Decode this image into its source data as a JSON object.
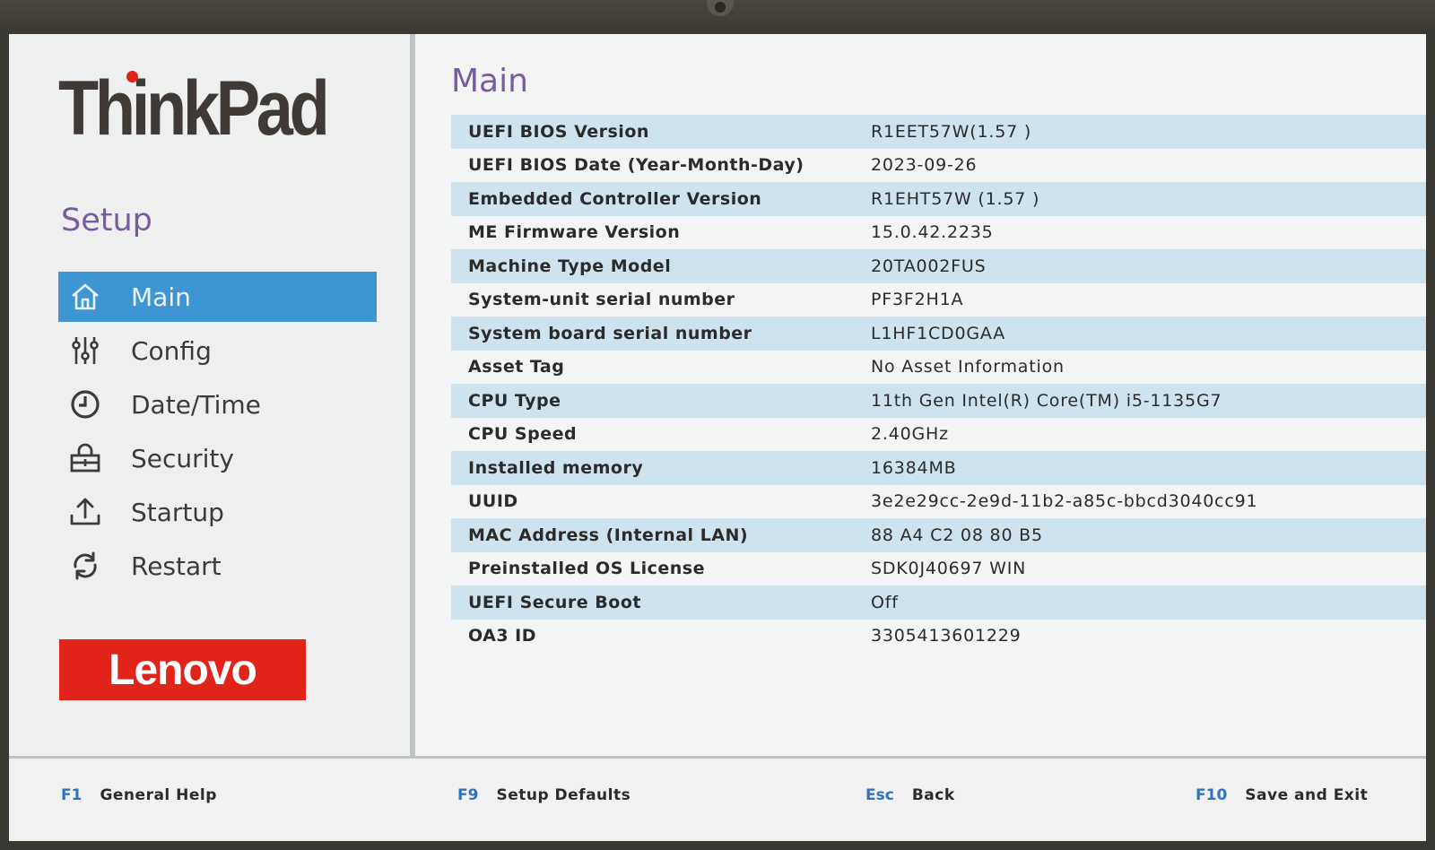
{
  "brand": {
    "name": "ThinkPad",
    "logo": "Lenovo"
  },
  "sidebar": {
    "title": "Setup",
    "items": [
      {
        "label": "Main",
        "icon": "home-icon",
        "active": true
      },
      {
        "label": "Config",
        "icon": "sliders-icon",
        "active": false
      },
      {
        "label": "Date/Time",
        "icon": "clock-icon",
        "active": false
      },
      {
        "label": "Security",
        "icon": "lock-icon",
        "active": false
      },
      {
        "label": "Startup",
        "icon": "upload-icon",
        "active": false
      },
      {
        "label": "Restart",
        "icon": "restart-icon",
        "active": false
      }
    ]
  },
  "main": {
    "title": "Main",
    "rows": [
      {
        "label": "UEFI BIOS Version",
        "value": "R1EET57W(1.57 )"
      },
      {
        "label": "UEFI BIOS Date (Year-Month-Day)",
        "value": "2023-09-26"
      },
      {
        "label": "Embedded Controller Version",
        "value": "R1EHT57W (1.57 )"
      },
      {
        "label": "ME Firmware Version",
        "value": "15.0.42.2235"
      },
      {
        "label": "Machine Type Model",
        "value": "20TA002FUS"
      },
      {
        "label": "System-unit serial number",
        "value": "PF3F2H1A"
      },
      {
        "label": "System board serial number",
        "value": "L1HF1CD0GAA"
      },
      {
        "label": "Asset Tag",
        "value": "No Asset Information"
      },
      {
        "label": "CPU Type",
        "value": "11th Gen Intel(R) Core(TM) i5-1135G7"
      },
      {
        "label": "CPU Speed",
        "value": "2.40GHz"
      },
      {
        "label": "Installed memory",
        "value": "16384MB"
      },
      {
        "label": "UUID",
        "value": "3e2e29cc-2e9d-11b2-a85c-bbcd3040cc91"
      },
      {
        "label": "MAC Address (Internal LAN)",
        "value": "88 A4 C2 08 80 B5"
      },
      {
        "label": "Preinstalled OS License",
        "value": "SDK0J40697 WIN"
      },
      {
        "label": "UEFI Secure Boot",
        "value": "Off"
      },
      {
        "label": "OA3 ID",
        "value": "3305413601229"
      }
    ]
  },
  "footer": {
    "help": {
      "key": "F1",
      "action": "General Help"
    },
    "defaults": {
      "key": "F9",
      "action": "Setup Defaults"
    },
    "back": {
      "key": "Esc",
      "action": "Back"
    },
    "save": {
      "key": "F10",
      "action": "Save and Exit"
    }
  },
  "colors": {
    "accent": "#3d95d2",
    "title": "#7a5aa0",
    "row_shade": "#cfe3ee",
    "lenovo_red": "#e2231a",
    "fkey": "#2f72c2"
  }
}
